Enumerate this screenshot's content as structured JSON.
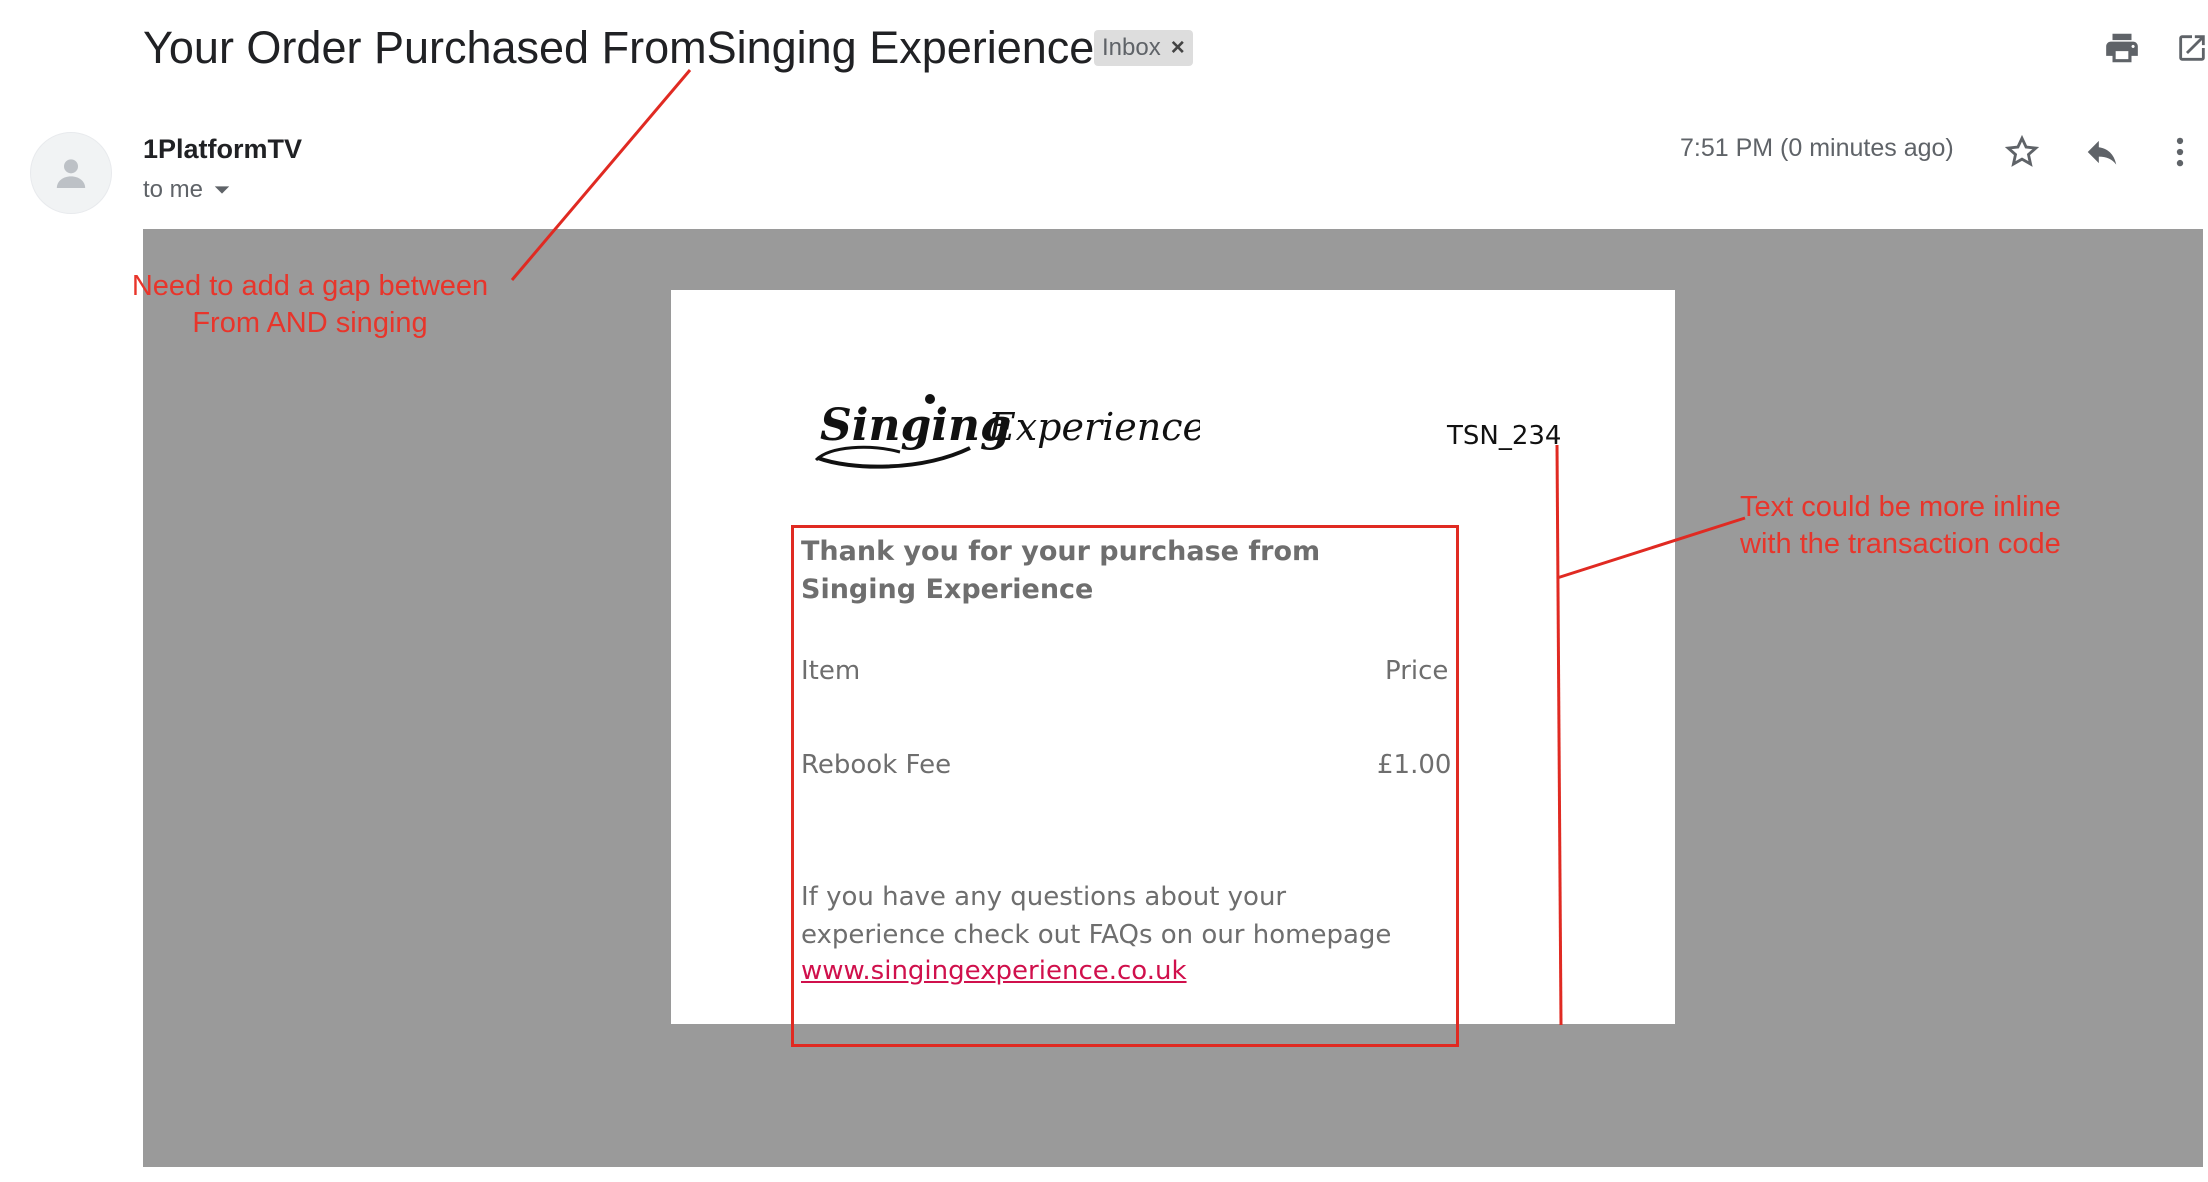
{
  "email": {
    "subject": "Your Order Purchased FromSinging Experience",
    "label_chip": "Inbox",
    "label_chip_close": "×",
    "sender": "1PlatformTV",
    "recipient": "to me",
    "timestamp": "7:51 PM (0 minutes ago)"
  },
  "icons": {
    "print": "print-icon",
    "open_new_window": "open-in-new-window-icon",
    "star": "star-icon",
    "reply": "reply-icon",
    "more": "more-vertical-icon",
    "avatar": "person-icon",
    "dropdown": "caret-down-icon"
  },
  "message": {
    "brand_logo_text": "SingingExperience",
    "transaction_code": "TSN_234",
    "thanks_heading": "Thank you for your purchase from Singing Experience",
    "item_header": "Item",
    "price_header": "Price",
    "item_name": "Rebook Fee",
    "item_price": "£1.00",
    "faq_text": "If you have any questions about your experience check out FAQs on our homepage",
    "website_link": "www.singingexperience.co.uk"
  },
  "annotations": {
    "note_gap": "Need to add a gap between From AND singing",
    "note_inline": "Text could be more inline with the transaction code"
  },
  "colors": {
    "annotation_red": "#e02a22",
    "link_pink": "#d0104c",
    "panel_gray": "#9a9a9a"
  }
}
